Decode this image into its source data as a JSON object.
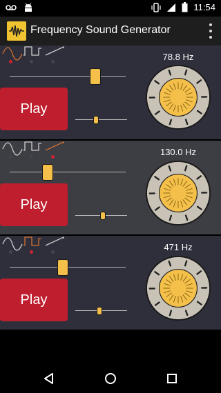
{
  "status": {
    "time": "11:54"
  },
  "app": {
    "title": "Frequency Sound Generator"
  },
  "colors": {
    "accent": "#f4c04a",
    "play": "#bf1e2e",
    "selected_wave": "#d07030",
    "dot_active": "#cc2233",
    "dot_inactive": "#44444c"
  },
  "generators": [
    {
      "frequency_label": "78.8 Hz",
      "selected_wave": "sine",
      "play_label": "Play",
      "frequency_slider": 0.77,
      "volume_slider": 0.4
    },
    {
      "frequency_label": "130.0 Hz",
      "selected_wave": "sawtooth",
      "play_label": "Play",
      "frequency_slider": 0.35,
      "volume_slider": 0.53
    },
    {
      "frequency_label": "471 Hz",
      "selected_wave": "square",
      "play_label": "Play",
      "frequency_slider": 0.52,
      "volume_slider": 0.47
    }
  ],
  "nav": {
    "icons": [
      "back-icon",
      "home-icon",
      "recents-icon"
    ]
  }
}
